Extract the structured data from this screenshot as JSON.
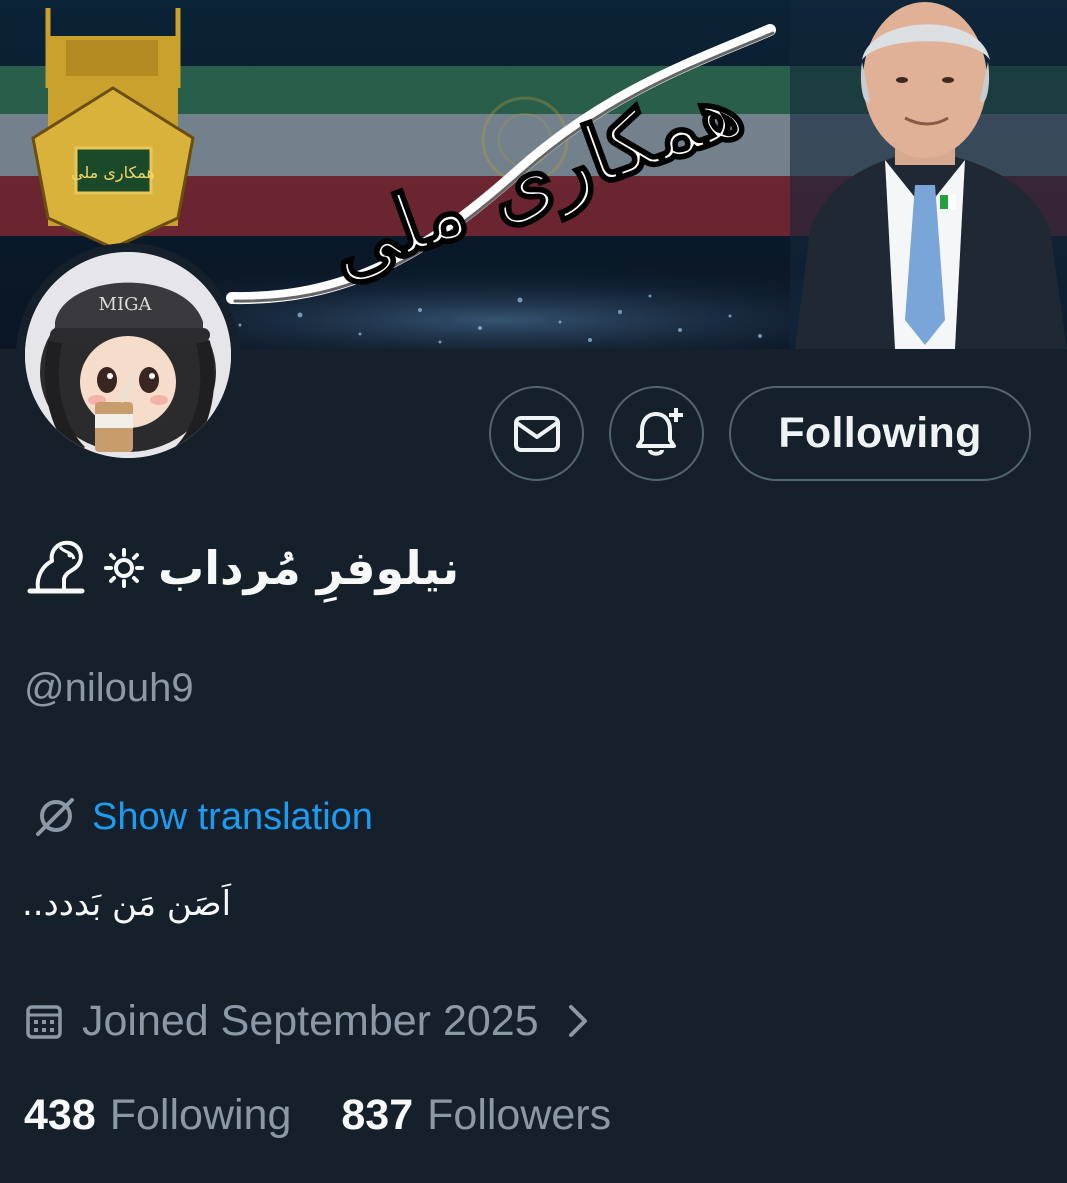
{
  "banner": {
    "calligraphy": "همکاری ملی",
    "emblem_text": "همکاری ملی"
  },
  "avatar": {
    "cap_text": "MIGA"
  },
  "actions": {
    "message_icon": "mail-icon",
    "notify_icon": "bell-plus-icon",
    "following_label": "Following"
  },
  "profile": {
    "display_name": "نیلوفرِ مُرداب",
    "name_icons": [
      "sun-icon",
      "lion-icon"
    ],
    "handle": "@nilouh9",
    "translate_label": "Show translation",
    "bio": "اَصَن مَن بَددد..",
    "joined": "Joined September 2025"
  },
  "stats": {
    "following_count": "438",
    "following_label": "Following",
    "followers_count": "837",
    "followers_label": "Followers"
  },
  "colors": {
    "background": "#15202b",
    "accent_link": "#1d9bf0",
    "muted_text": "#8b98a5",
    "button_border": "#536471"
  }
}
